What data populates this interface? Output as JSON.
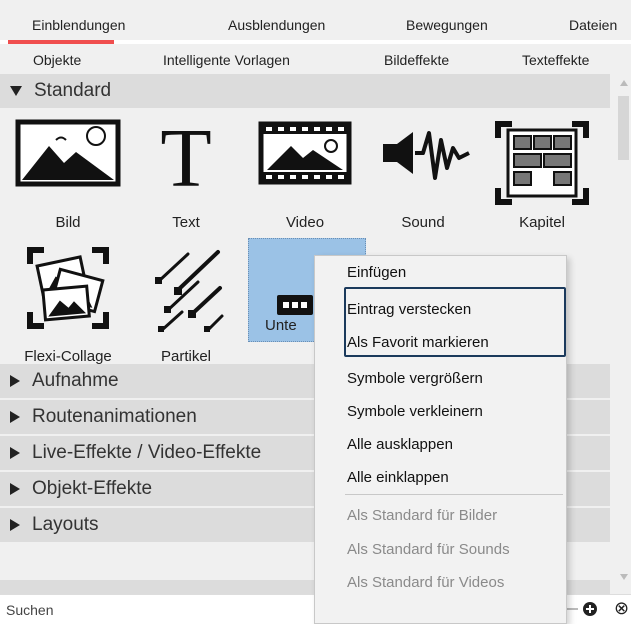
{
  "tabs_top": [
    "Einblendungen",
    "Ausblendungen",
    "Bewegungen",
    "Dateien"
  ],
  "tabs_second": [
    "Objekte",
    "Intelligente Vorlagen",
    "Bildeffekte",
    "Texteffekte"
  ],
  "sections": {
    "standard": "Standard",
    "collapsed": [
      "Aufnahme",
      "Routenanimationen",
      "Live-Effekte / Video-Effekte",
      "Objekt-Effekte",
      "Layouts"
    ]
  },
  "items": [
    {
      "label": "Bild",
      "icon": "image-icon"
    },
    {
      "label": "Text",
      "icon": "text-icon"
    },
    {
      "label": "Video",
      "icon": "video-icon"
    },
    {
      "label": "Sound",
      "icon": "sound-icon"
    },
    {
      "label": "Kapitel",
      "icon": "chapter-icon"
    },
    {
      "label": "Flexi-Collage",
      "icon": "collage-icon"
    },
    {
      "label": "Partikel",
      "icon": "particles-icon"
    },
    {
      "label": "Unte",
      "icon": "subtitle-icon"
    }
  ],
  "context_menu": [
    "Einfügen",
    "Eintrag verstecken",
    "Als Favorit markieren",
    "Symbole vergrößern",
    "Symbole verkleinern",
    "Alle ausklappen",
    "Alle einklappen",
    "Als Standard für Bilder",
    "Als Standard für Sounds",
    "Als Standard für Videos"
  ],
  "search": {
    "placeholder": "Suchen",
    "clear": "×"
  },
  "colors": {
    "accent": "#f04e4e",
    "selection": "#9bc2e6",
    "highlight_border": "#1b3a5c"
  }
}
